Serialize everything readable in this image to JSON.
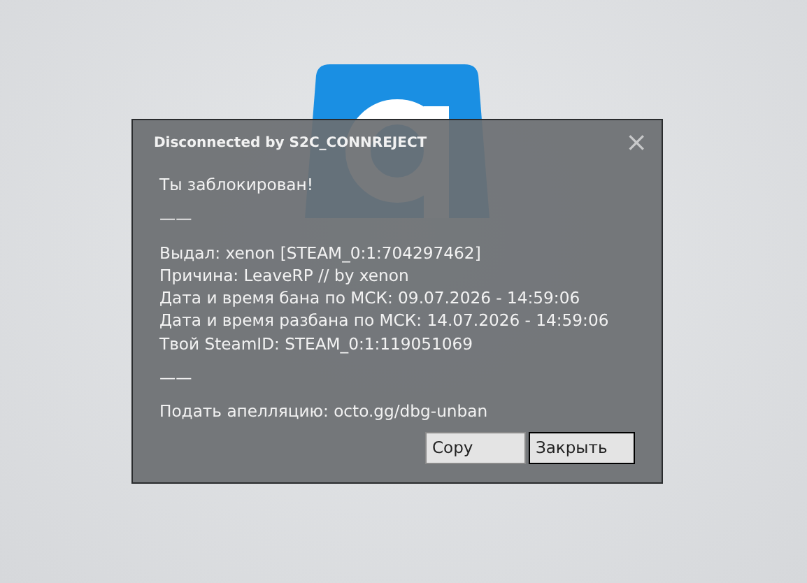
{
  "dialog": {
    "title": "Disconnected by S2C_CONNREJECT",
    "close": "×",
    "paragraphs": [
      [
        "Ты заблокирован!"
      ],
      [
        "——"
      ],
      [
        "Выдал: xenon [STEAM_0:1:704297462]",
        "Причина: LeaveRP // by xenon",
        "Дата и время бана по МСК: 09.07.2026 - 14:59:06",
        "Дата и время разбана по МСК: 14.07.2026 - 14:59:06",
        "Твой SteamID: STEAM_0:1:119051069"
      ],
      [
        "——"
      ],
      [
        "Подать апелляцию: octo.gg/dbg-unban"
      ]
    ],
    "buttons": [
      {
        "label": "Copy",
        "focused": false
      },
      {
        "label": "Закрыть",
        "focused": true
      }
    ]
  }
}
